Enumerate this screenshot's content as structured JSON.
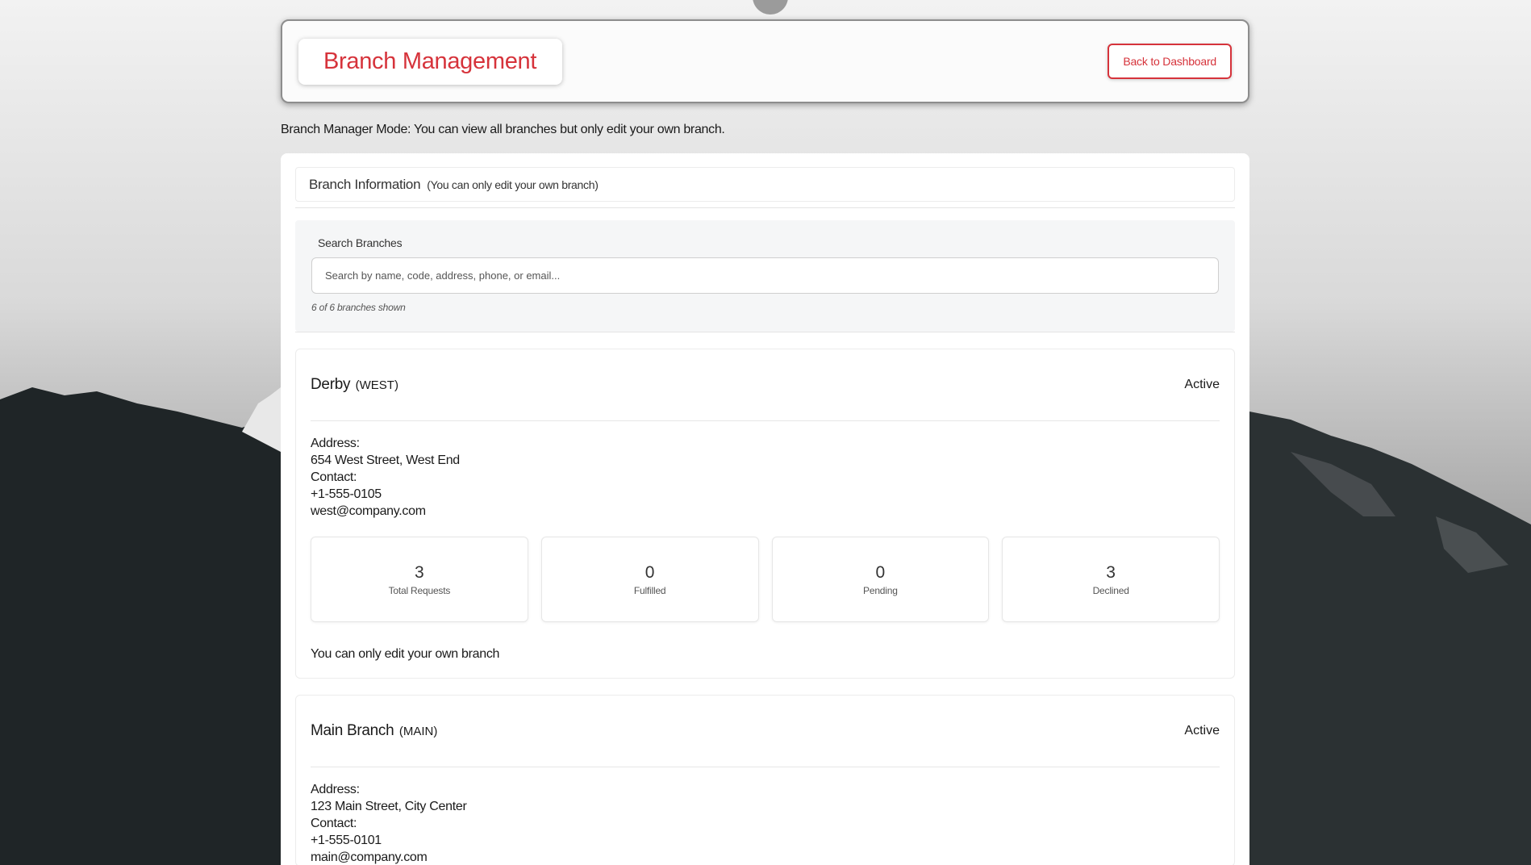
{
  "header": {
    "title": "Branch Management",
    "back_label": "Back to Dashboard"
  },
  "mode_note": "Branch Manager Mode: You can view all branches but only edit your own branch.",
  "info": {
    "title": "Branch Information",
    "subtitle": "(You can only edit your own branch)"
  },
  "search": {
    "label": "Search Branches",
    "placeholder": "Search by name, code, address, phone, or email...",
    "count": "6 of 6 branches shown"
  },
  "branches": [
    {
      "name": "Derby",
      "code": "(WEST)",
      "status": "Active",
      "address_label": "Address:",
      "address": "654 West Street, West End",
      "contact_label": "Contact:",
      "phone": "+1-555-0105",
      "email": "west@company.com",
      "stats": [
        {
          "value": "3",
          "label": "Total Requests"
        },
        {
          "value": "0",
          "label": "Fulfilled"
        },
        {
          "value": "0",
          "label": "Pending"
        },
        {
          "value": "3",
          "label": "Declined"
        }
      ],
      "note": "You can only edit your own branch"
    },
    {
      "name": "Main Branch",
      "code": "(MAIN)",
      "status": "Active",
      "address_label": "Address:",
      "address": "123 Main Street, City Center",
      "contact_label": "Contact:",
      "phone": "+1-555-0101",
      "email": "main@company.com"
    }
  ],
  "colors": {
    "accent": "#d6333b",
    "panel": "#ffffff",
    "search_bg": "#f5f6f7"
  }
}
